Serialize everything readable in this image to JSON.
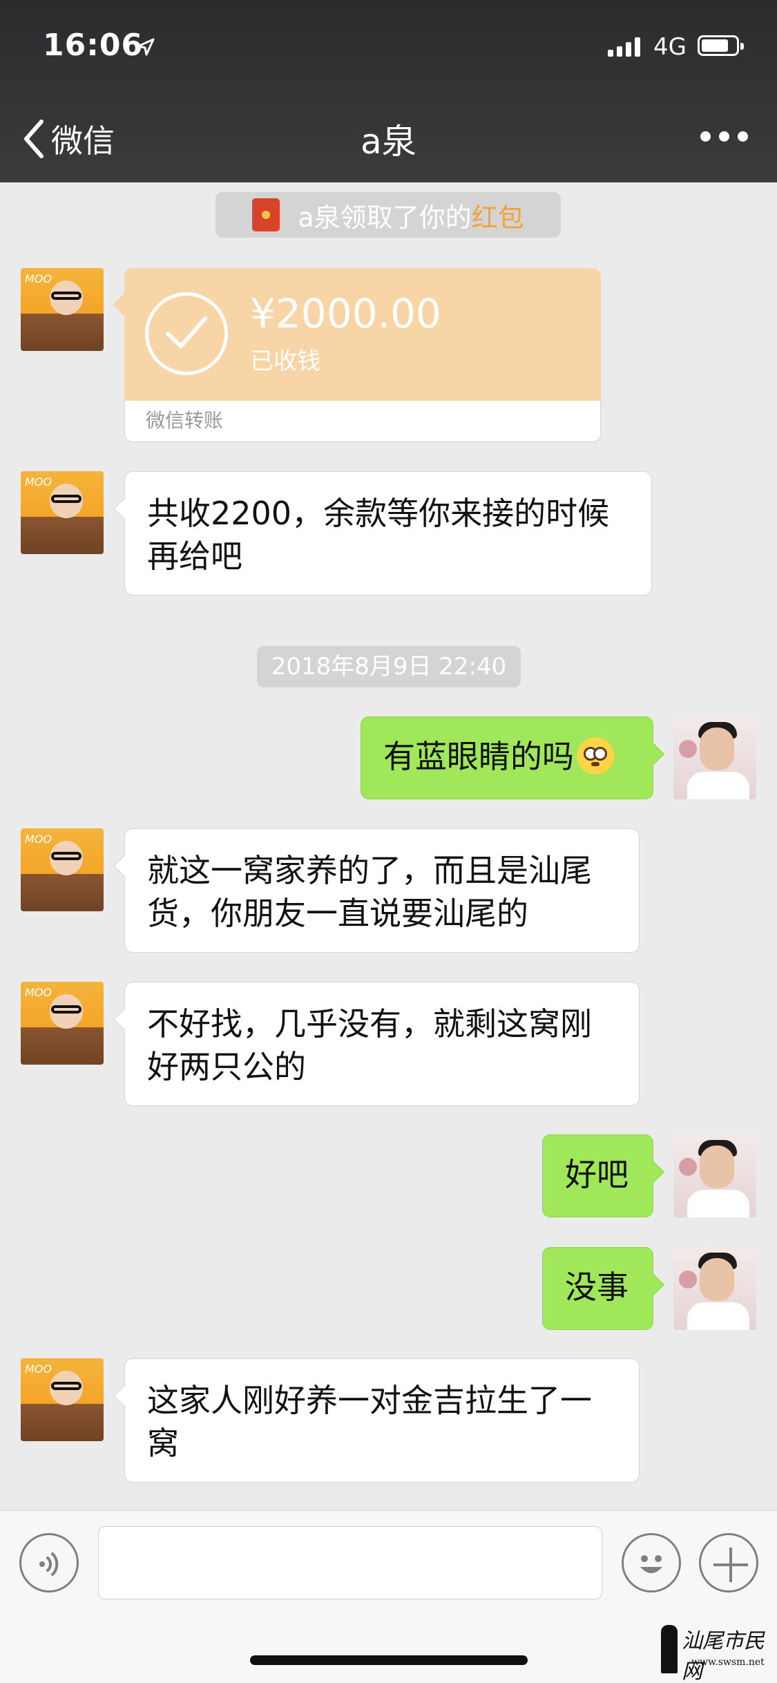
{
  "status_bar": {
    "time": "16:06",
    "network": "4G",
    "icons": [
      "location-arrow-icon",
      "signal-bars-icon",
      "battery-icon"
    ]
  },
  "nav": {
    "back_label": "微信",
    "title": "a泉",
    "icons": [
      "chevron-left-icon",
      "more-dots-icon"
    ]
  },
  "messages": [
    {
      "type": "system",
      "text_before": "a泉领取了你的",
      "text_accent": "红包",
      "accent_color": "#f2a33a"
    },
    {
      "type": "transfer",
      "side": "left",
      "amount": "¥2000.00",
      "status": "已收钱",
      "footer": "微信转账",
      "color": "#f8d5a7"
    },
    {
      "type": "text",
      "side": "left",
      "lines": [
        "共收2200，余款等你来接的时候",
        "再给吧"
      ]
    },
    {
      "type": "time",
      "text": "2018年8月9日 22:40"
    },
    {
      "type": "text",
      "side": "right",
      "text": "有蓝眼睛的吗",
      "emoji": "flushed-face-icon"
    },
    {
      "type": "text",
      "side": "left",
      "lines": [
        "就这一窝家养的了，而且是汕尾",
        "货，你朋友一直说要汕尾的"
      ]
    },
    {
      "type": "text",
      "side": "left",
      "lines": [
        "不好找，几乎没有，就剩这窝刚",
        "好两只公的"
      ]
    },
    {
      "type": "text",
      "side": "right",
      "text": "好吧"
    },
    {
      "type": "text",
      "side": "right",
      "text": "没事"
    },
    {
      "type": "text",
      "side": "left",
      "lines": [
        "这家人刚好养一对金吉拉生了一",
        "窝"
      ]
    }
  ],
  "input_bar": {
    "icons": [
      "voice-icon",
      "emoji-icon",
      "plus-icon"
    ]
  },
  "watermark": {
    "text": "汕尾市民网",
    "url": "www.swsm.net"
  },
  "colors": {
    "nav_bg": "#2f2f31",
    "chat_bg": "#ebebeb",
    "sent_bubble": "#a0e75a",
    "received_bubble": "#ffffff"
  }
}
